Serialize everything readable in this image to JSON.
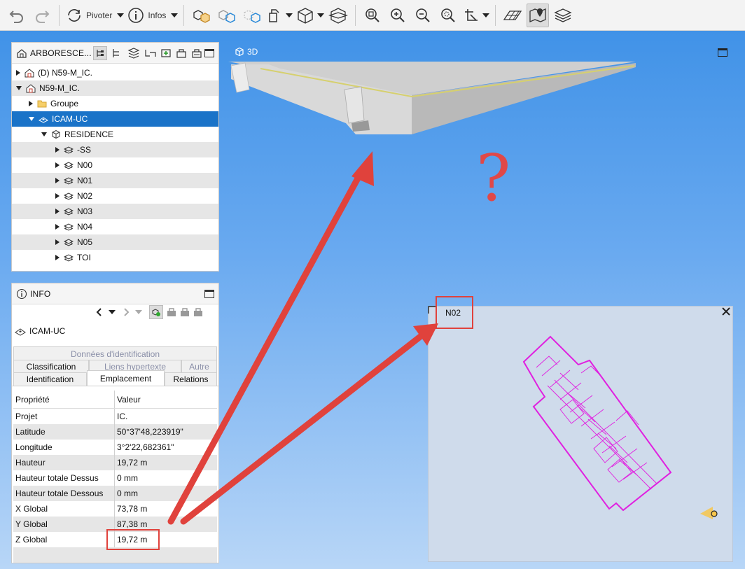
{
  "toolbar": {
    "undo_icon": "undo-icon",
    "redo_icon": "redo-icon",
    "pivot_label": "Pivoter",
    "info_label": "Infos"
  },
  "view3d": {
    "label": "3D"
  },
  "tree_panel": {
    "title": "ARBORESCE...",
    "rows": [
      {
        "label": "(D) N59-M_IC.",
        "icon": "building-icon"
      },
      {
        "label": "N59-M_IC.",
        "icon": "building-icon"
      },
      {
        "label": "Groupe",
        "icon": "folder-icon"
      },
      {
        "label": "ICAM-UC",
        "icon": "site-icon"
      },
      {
        "label": "RESIDENCE",
        "icon": "cube-icon"
      },
      {
        "label": "-SS",
        "icon": "level-icon"
      },
      {
        "label": "N00",
        "icon": "level-icon"
      },
      {
        "label": "N01",
        "icon": "level-icon"
      },
      {
        "label": "N02",
        "icon": "level-icon"
      },
      {
        "label": "N03",
        "icon": "level-icon"
      },
      {
        "label": "N04",
        "icon": "level-icon"
      },
      {
        "label": "N05",
        "icon": "level-icon"
      },
      {
        "label": "TOI",
        "icon": "level-icon"
      }
    ]
  },
  "info_panel": {
    "title": "INFO",
    "object_name": "ICAM-UC",
    "tabs": {
      "donnees": "Données d'identification",
      "classification": "Classification",
      "liens": "Liens hypertexte",
      "autre": "Autre",
      "identification": "Identification",
      "emplacement": "Emplacement",
      "relations": "Relations"
    },
    "table_header": {
      "key": "Propriété",
      "value": "Valeur"
    },
    "properties": [
      {
        "key": "Projet",
        "value": "IC."
      },
      {
        "key": "Latitude",
        "value": "50°37'48,223919\""
      },
      {
        "key": "Longitude",
        "value": "3°2'22,682361\""
      },
      {
        "key": "Hauteur",
        "value": "19,72 m"
      },
      {
        "key": "Hauteur totale Dessus",
        "value": "0 mm"
      },
      {
        "key": "Hauteur totale Dessous",
        "value": "0 mm"
      },
      {
        "key": "X Global",
        "value": "73,78 m"
      },
      {
        "key": "Y Global",
        "value": "87,38 m"
      },
      {
        "key": "Z Global",
        "value": "19,72 m"
      }
    ]
  },
  "plan_view": {
    "label": "N02"
  },
  "annotation": {
    "question_mark": "?"
  },
  "colors": {
    "selection": "#1a73c8",
    "highlight": "#e0423c",
    "plan_lines": "#e020e0"
  }
}
